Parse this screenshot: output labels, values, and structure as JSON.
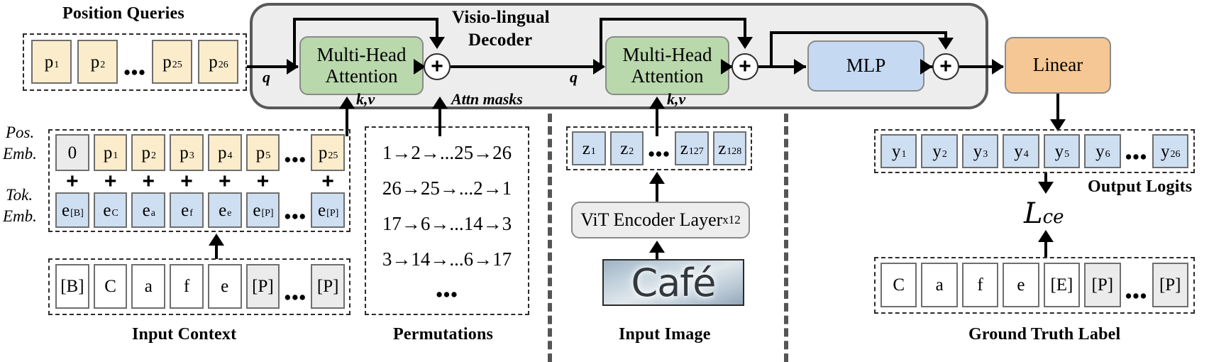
{
  "title": "Visio-lingual Decoder architecture (PARSeq-style)",
  "sections": {
    "position_queries_label": "Position Queries",
    "input_context_label": "Input Context",
    "permutations_label": "Permutations",
    "input_image_label": "Input Image",
    "output_logits_label": "Output Logits",
    "ground_truth_label": "Ground Truth Label",
    "pos_emb_label_line1": "Pos.",
    "pos_emb_label_line2": "Emb.",
    "tok_emb_label_line1": "Tok.",
    "tok_emb_label_line2": "Emb."
  },
  "decoder": {
    "title_line1": "Visio-lingual",
    "title_line2": "Decoder",
    "blocks": {
      "mha1_line1": "Multi-Head",
      "mha1_line2": "Attention",
      "mha2_line1": "Multi-Head",
      "mha2_line2": "Attention",
      "mlp": "MLP",
      "linear": "Linear"
    },
    "edge_labels": {
      "q1": "q",
      "q2": "q",
      "kv1": "k,v",
      "kv2": "k,v",
      "attn_masks": "Attn masks",
      "plus1": "+",
      "plus2": "+",
      "plus3": "+"
    }
  },
  "encoder": {
    "name": "ViT Encoder Layer",
    "repeat": "x12",
    "image_text": "Café"
  },
  "loss": {
    "symbol": "L",
    "subscript": "ce"
  },
  "position_queries": [
    {
      "text": "p",
      "sub": "1"
    },
    {
      "text": "p",
      "sub": "2"
    },
    {
      "text": "…",
      "sub": ""
    },
    {
      "text": "p",
      "sub": "25"
    },
    {
      "text": "p",
      "sub": "26"
    }
  ],
  "pos_embeddings": [
    {
      "text": "0",
      "sub": "",
      "style": "grey"
    },
    {
      "text": "p",
      "sub": "1",
      "style": "yellow"
    },
    {
      "text": "p",
      "sub": "2",
      "style": "yellow"
    },
    {
      "text": "p",
      "sub": "3",
      "style": "yellow"
    },
    {
      "text": "p",
      "sub": "4",
      "style": "yellow"
    },
    {
      "text": "p",
      "sub": "5",
      "style": "yellow"
    },
    {
      "text": "…",
      "sub": "",
      "style": "dots"
    },
    {
      "text": "p",
      "sub": "25",
      "style": "yellow"
    }
  ],
  "tok_embeddings": [
    {
      "text": "e",
      "sub": "[B]",
      "style": "blue"
    },
    {
      "text": "e",
      "sub": "C",
      "style": "blue"
    },
    {
      "text": "e",
      "sub": "a",
      "style": "blue"
    },
    {
      "text": "e",
      "sub": "f",
      "style": "blue"
    },
    {
      "text": "e",
      "sub": "e",
      "style": "blue"
    },
    {
      "text": "e",
      "sub": "[P]",
      "style": "blue"
    },
    {
      "text": "…",
      "sub": "",
      "style": "dots"
    },
    {
      "text": "e",
      "sub": "[P]",
      "style": "blue"
    }
  ],
  "plus_row": [
    "+",
    "+",
    "+",
    "+",
    "+",
    "+",
    "+"
  ],
  "input_context": [
    {
      "text": "[B]",
      "style": "white"
    },
    {
      "text": "C",
      "style": "white"
    },
    {
      "text": "a",
      "style": "white"
    },
    {
      "text": "f",
      "style": "white"
    },
    {
      "text": "e",
      "style": "white"
    },
    {
      "text": "[P]",
      "style": "grey"
    },
    {
      "text": "…",
      "style": "dots"
    },
    {
      "text": "[P]",
      "style": "grey"
    }
  ],
  "permutations": [
    "1→2→...25→26",
    "26→25→...2→1",
    "17→6→...14→3",
    "3→14→...6→17",
    "..."
  ],
  "image_tokens": [
    {
      "text": "z",
      "sub": "1",
      "style": "blue"
    },
    {
      "text": "z",
      "sub": "2",
      "style": "blue"
    },
    {
      "text": "…",
      "sub": "",
      "style": "dots"
    },
    {
      "text": "z",
      "sub": "127",
      "style": "blue"
    },
    {
      "text": "z",
      "sub": "128",
      "style": "blue"
    }
  ],
  "output_logits": [
    {
      "text": "y",
      "sub": "1",
      "style": "blue"
    },
    {
      "text": "y",
      "sub": "2",
      "style": "blue"
    },
    {
      "text": "y",
      "sub": "3",
      "style": "blue"
    },
    {
      "text": "y",
      "sub": "4",
      "style": "blue"
    },
    {
      "text": "y",
      "sub": "5",
      "style": "blue"
    },
    {
      "text": "y",
      "sub": "6",
      "style": "blue"
    },
    {
      "text": "…",
      "sub": "",
      "style": "dots"
    },
    {
      "text": "y",
      "sub": "26",
      "style": "blue"
    }
  ],
  "ground_truth": [
    {
      "text": "C",
      "style": "white"
    },
    {
      "text": "a",
      "style": "white"
    },
    {
      "text": "f",
      "style": "white"
    },
    {
      "text": "e",
      "style": "white"
    },
    {
      "text": "[E]",
      "style": "white"
    },
    {
      "text": "[P]",
      "style": "grey"
    },
    {
      "text": "…",
      "style": "dots"
    },
    {
      "text": "[P]",
      "style": "grey"
    }
  ],
  "colors": {
    "attention_green": "#b9d8ac",
    "mlp_blue": "#c6d9f2",
    "linear_orange": "#f5c794",
    "query_yellow": "#fbeccb",
    "token_blue": "#cfdff2",
    "pad_grey": "#ebebeb",
    "decoder_bg": "#ededed",
    "decoder_border": "#595959"
  }
}
